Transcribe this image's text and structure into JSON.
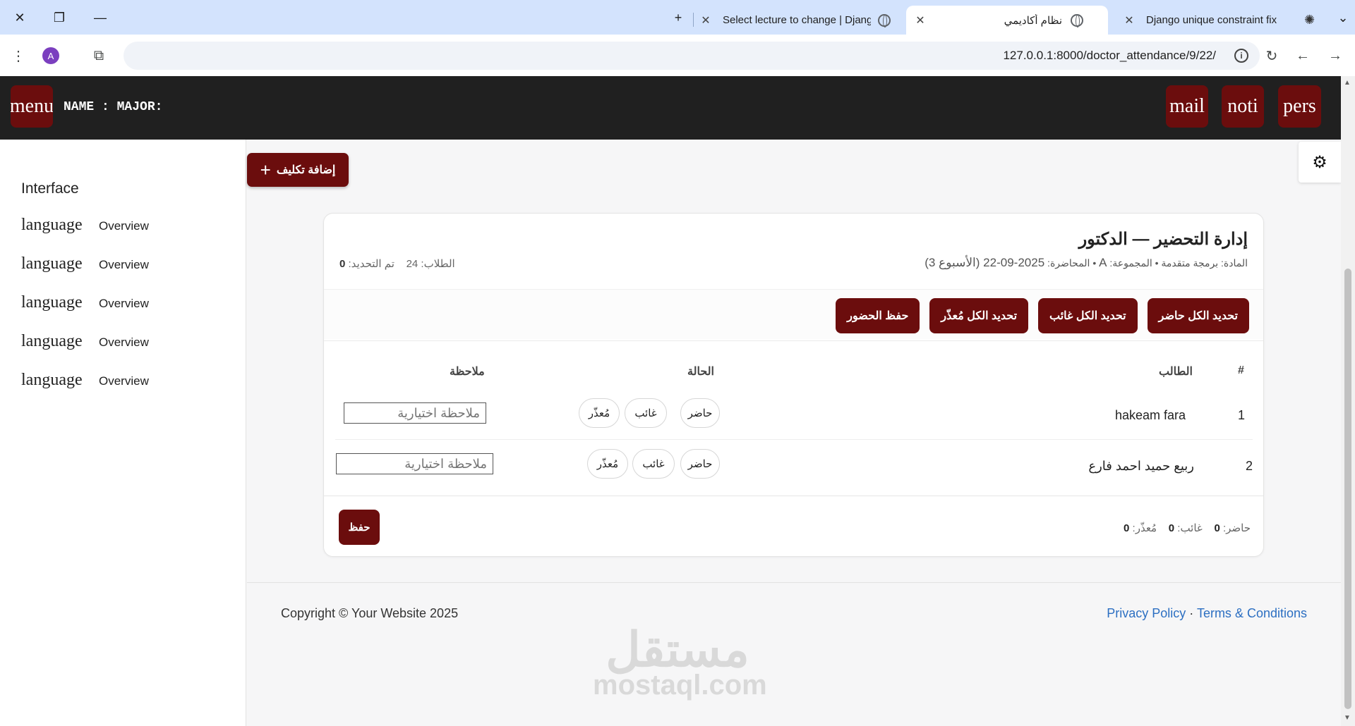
{
  "browser": {
    "tabs": [
      {
        "title": "Select lecture to change | Djang",
        "active": false
      },
      {
        "title": "نظام أكاديمي",
        "active": true
      },
      {
        "title": "Django unique constraint fix",
        "active": false
      }
    ],
    "url": "127.0.0.1:8000/doctor_attendance/9/22/",
    "profile_initial": "A"
  },
  "topnav": {
    "menu_label": "menu",
    "name_major": "NAME : MAJOR:",
    "right_buttons": [
      "mail",
      "noti",
      "pers"
    ]
  },
  "sidebar": {
    "heading": "Interface",
    "items": [
      {
        "label": "language",
        "sub": "Overview"
      },
      {
        "label": "language",
        "sub": "Overview"
      },
      {
        "label": "language",
        "sub": "Overview"
      },
      {
        "label": "language",
        "sub": "Overview"
      },
      {
        "label": "language",
        "sub": "Overview"
      }
    ]
  },
  "add_task_label": "إضافة تكليف",
  "card": {
    "title": "إدارة التحضير — الدكتور",
    "subtitle_prefix": "المادة: برمجة متقدمة • المجموعة: ",
    "group": "A",
    "subtitle_mid": " • المحاضرة: ",
    "date": "2025-09-22",
    "week": " (الأسبوع 3)",
    "students_label": "الطلاب:",
    "students_count": "24",
    "updated_label": "تم التحديد:",
    "updated_count": "0",
    "actions": [
      "تحديد الكل حاضر",
      "تحديد الكل غائب",
      "تحديد الكل مُعذّر",
      "حفظ الحضور"
    ],
    "columns": {
      "num": "#",
      "student": "الطالب",
      "status": "الحالة",
      "note": "ملاحظة"
    },
    "rows": [
      {
        "num": "1",
        "name": "hakeam fara",
        "status": [
          "حاضر",
          "غائب",
          "مُعذّر"
        ],
        "note_placeholder": "ملاحظة اختيارية"
      },
      {
        "num": "2",
        "name": "ربيع حميد احمد فارع",
        "status": [
          "حاضر",
          "غائب",
          "مُعذّر"
        ],
        "note_placeholder": "ملاحظة اختيارية"
      }
    ],
    "save_label": "حفظ",
    "summary": {
      "present_label": "حاضر:",
      "present": "0",
      "absent_label": "غائب:",
      "absent": "0",
      "excused_label": "مُعذّر:",
      "excused": "0"
    }
  },
  "footer": {
    "copyright": "Copyright © Your Website 2025",
    "privacy": "Privacy Policy",
    "sep": "·",
    "terms": "Terms & Conditions"
  },
  "watermark": {
    "arabic": "مستقل",
    "latin": "mostaql.com"
  },
  "colors": {
    "brand": "#6b0d0d",
    "nav": "#202020",
    "tabbar": "#d3e3fd",
    "link": "#2c6fc2"
  }
}
